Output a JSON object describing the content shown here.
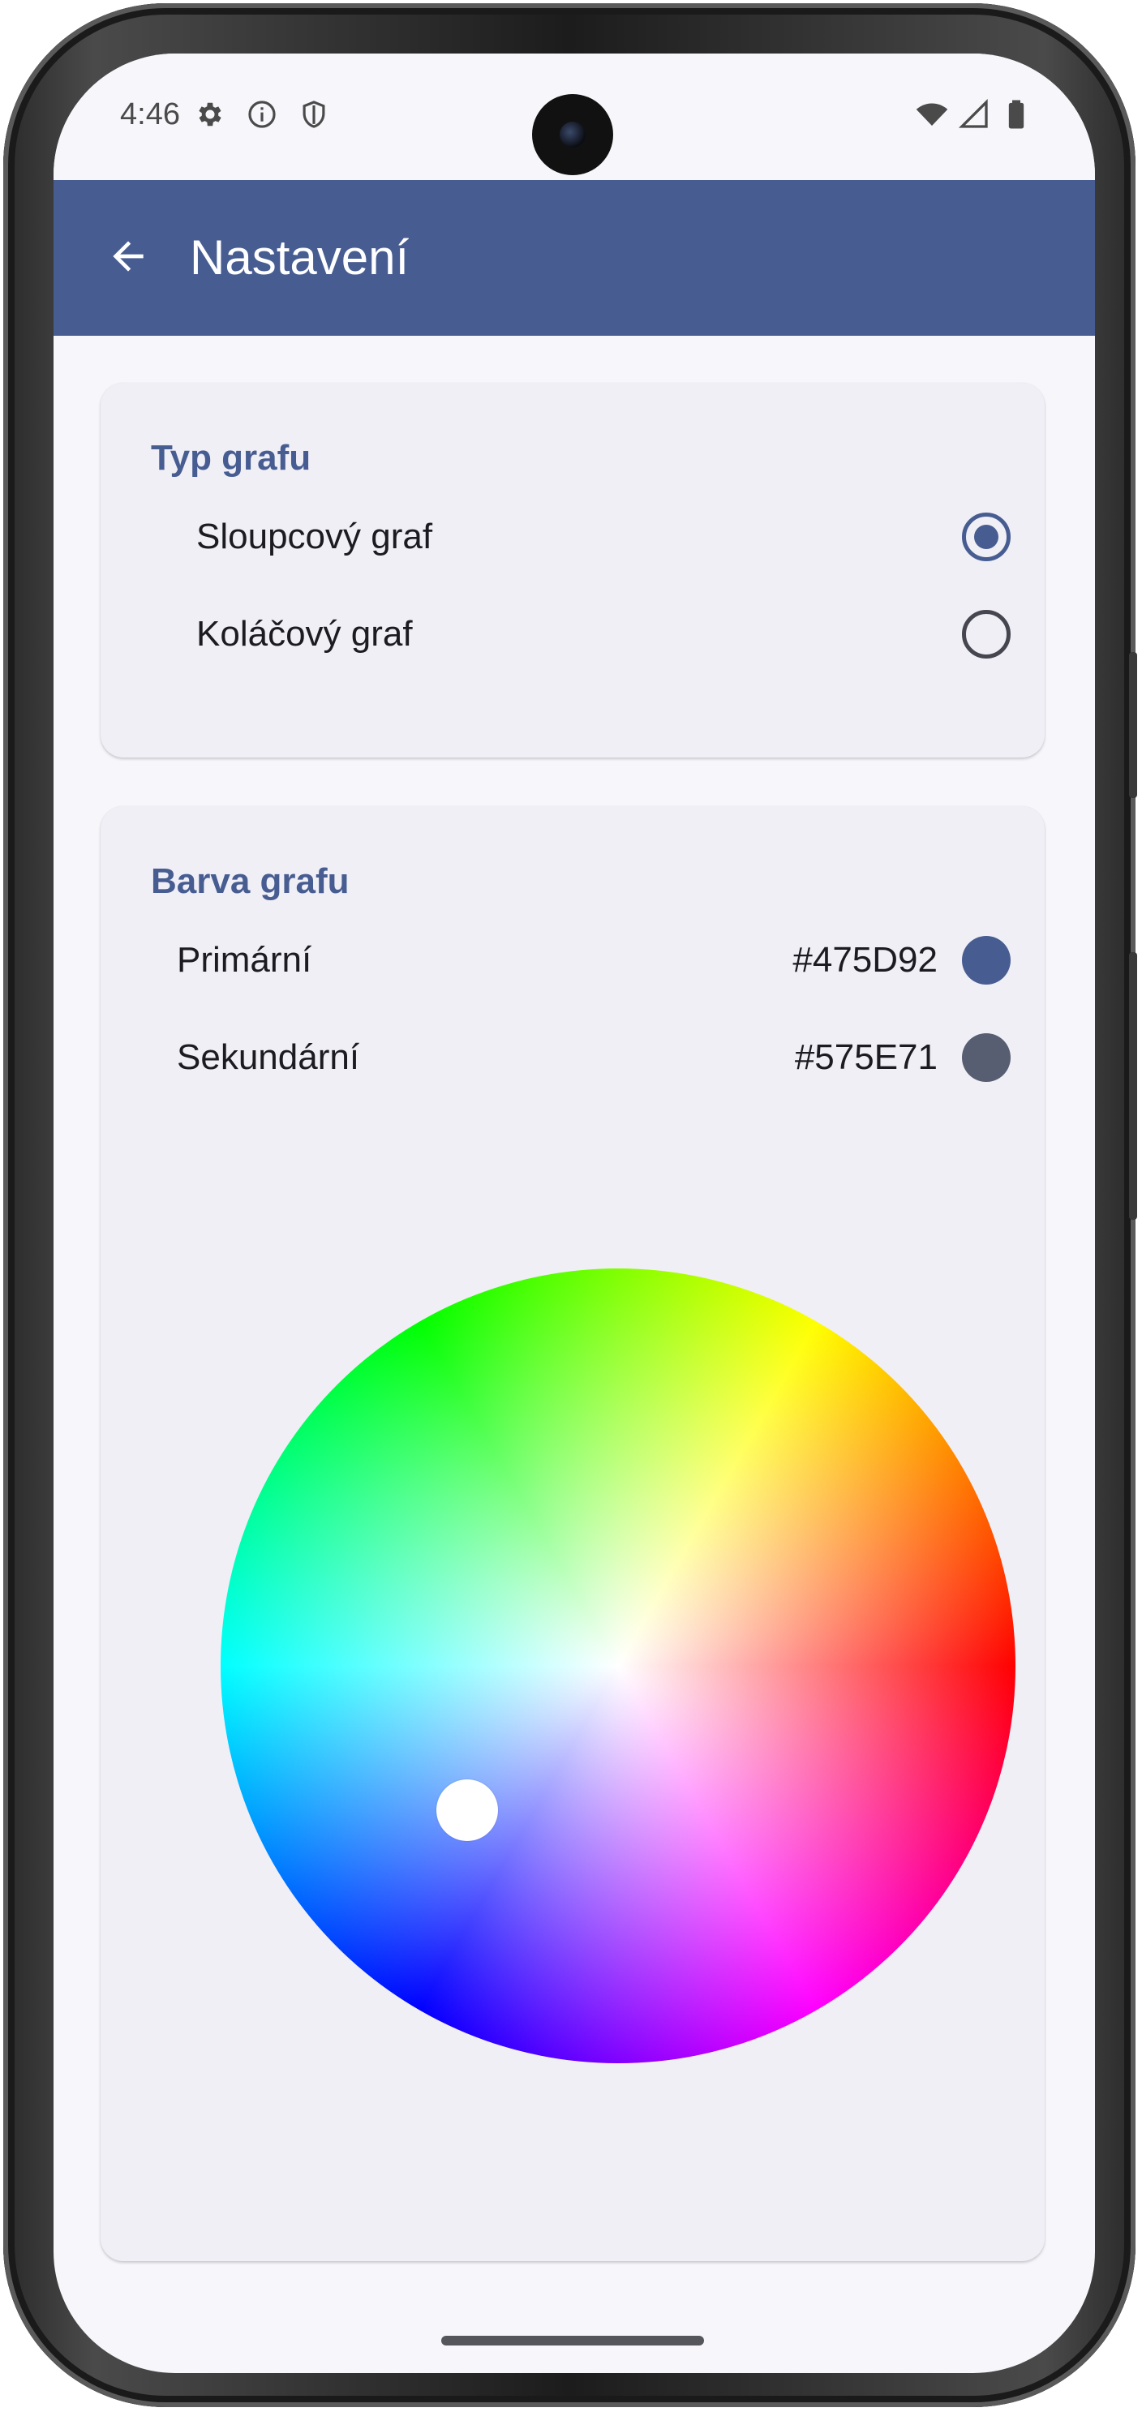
{
  "status_bar": {
    "time": "4:46",
    "left_icons": [
      "gear-icon",
      "info-icon",
      "shield-icon"
    ],
    "right_icons": [
      "wifi-icon",
      "signal-icon",
      "battery-icon"
    ]
  },
  "app_bar": {
    "title": "Nastavení",
    "background": "#475D92"
  },
  "chart_type": {
    "title": "Typ grafu",
    "options": [
      {
        "label": "Sloupcový graf",
        "selected": true
      },
      {
        "label": "Koláčový graf",
        "selected": false
      }
    ]
  },
  "chart_color": {
    "title": "Barva grafu",
    "colors": [
      {
        "label": "Primární",
        "hex": "#475D92"
      },
      {
        "label": "Sekundární",
        "hex": "#575E71"
      }
    ]
  },
  "colors": {
    "accent": "#475D92",
    "card": "#F0EFF6",
    "screen": "#F6F6FB"
  }
}
